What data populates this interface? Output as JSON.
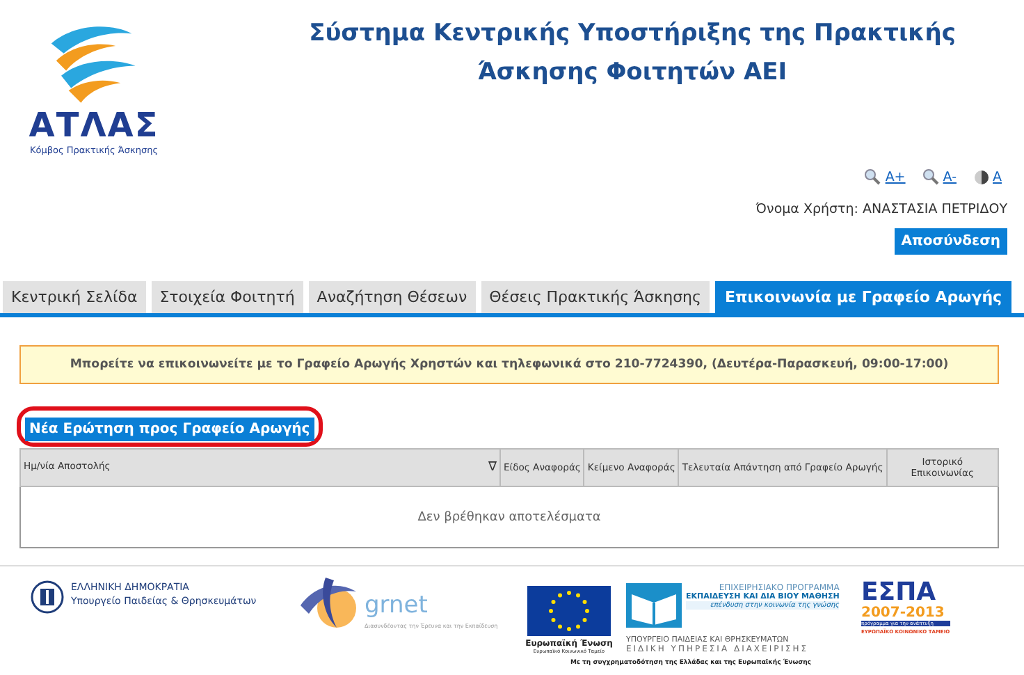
{
  "logo": {
    "name": "ΑΤΛΑΣ",
    "subtitle": "Κόμβος Πρακτικής Άσκησης"
  },
  "title": "Σύστημα Κεντρικής Υποστήριξης της Πρακτικής Άσκησης Φοιτητών ΑΕΙ",
  "accessibility": [
    {
      "kind": "zoom-in",
      "label": "A+"
    },
    {
      "kind": "zoom-out",
      "label": "A-"
    },
    {
      "kind": "contrast",
      "label": "A"
    }
  ],
  "user": "Όνομα Χρήστη: ΑΝΑΣΤΑΣΙΑ ΠΕΤΡΙΔΟΥ",
  "logout": "Αποσύνδεση",
  "tabs": [
    {
      "label": "Κεντρική Σελίδα",
      "selected": false
    },
    {
      "label": "Στοιχεία Φοιτητή",
      "selected": false
    },
    {
      "label": "Αναζήτηση Θέσεων",
      "selected": false
    },
    {
      "label": "Θέσεις Πρακτικής Άσκησης",
      "selected": false
    },
    {
      "label": "Επικοινωνία με Γραφείο Αρωγής",
      "selected": true
    }
  ],
  "notice": "Μπορείτε να επικοινωνείτε με το Γραφείο Αρωγής Χρηστών και τηλεφωνικά στο 210-7724390, (Δευτέρα-Παρασκευή, 09:00-17:00)",
  "new_question": {
    "label": "Νέα Ερώτηση προς Γραφείο Αρωγής",
    "highlighted": true
  },
  "table": {
    "columns": [
      {
        "label": "Ημ/νία Αποστολής",
        "sort": "∇"
      },
      {
        "label": "Είδος Αναφοράς"
      },
      {
        "label": "Κείμενο Αναφοράς"
      },
      {
        "label": "Τελευταία Απάντηση από Γραφείο Αρωγής"
      },
      {
        "label": "Ιστορικό Επικοινωνίας"
      }
    ],
    "empty": "Δεν βρέθηκαν αποτελέσματα"
  },
  "footer": {
    "gov": [
      "ΕΛΛΗΝΙΚΗ ΔΗΜΟΚΡΑΤΙΑ",
      "Υπουργείο Παιδείας & Θρησκευμάτων"
    ],
    "grnet": [
      "grnet",
      "Διασυνδέοντας την Έρευνα και την Εκπαίδευση"
    ],
    "eu": [
      "Ευρωπαϊκή Ένωση",
      "Ευρωπαϊκό Κοινωνικό Ταμείο"
    ],
    "program": [
      "ΕΠΙΧΕΙΡΗΣΙΑΚΟ ΠΡΟΓΡΑΜΜΑ",
      "ΕΚΠΑΙΔΕΥΣΗ ΚΑΙ ΔΙΑ ΒΙΟΥ ΜΑΘΗΣΗ",
      "επένδυση στην κοινωνία της γνώσης",
      "ΥΠΟΥΡΓΕΙΟ ΠΑΙΔΕΙΑΣ ΚΑΙ ΘΡΗΣΚΕΥΜΑΤΩΝ",
      "ΕΙΔΙΚΗ ΥΠΗΡΕΣΙΑ ΔΙΑΧΕΙΡΙΣΗΣ"
    ],
    "cofunding": "Με τη συγχρηματοδότηση της Ελλάδας και της Ευρωπαϊκής Ένωσης",
    "espa": [
      "ΕΣΠΑ",
      "2007-2013",
      "πρόγραμμα για την ανάπτυξη",
      "ΕΥΡΩΠΑΪΚΟ ΚΟΙΝΩΝΙΚΟ ΤΑΜΕΙΟ"
    ]
  }
}
